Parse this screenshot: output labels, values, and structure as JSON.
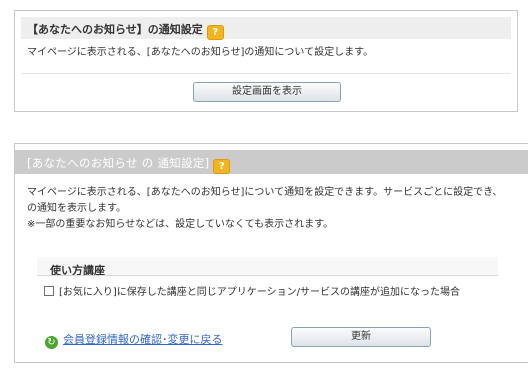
{
  "panel1": {
    "title": "【あなたへのお知らせ】の通知設定",
    "help_icon_label": "?",
    "description": "マイページに表示される、[あなたへのお知らせ]の通知について設定します。",
    "show_settings_button": "設定画面を表示"
  },
  "panel2": {
    "title": "[あなたへのお知らせ の 通知設定]",
    "help_icon_label": "?",
    "description_lines": [
      "マイページに表示される、[あなたへのお知らせ]について通知を設定できます。サービスごとに設定でき、",
      "の通知を表示します。",
      "※一部の重要なお知らせなどは、設定していなくても表示されます。"
    ],
    "section_title": "使い方講座",
    "checkbox_label": "[お気に入り]に保存した講座と同じアプリケーション/サービスの講座が追加になった場合",
    "checkbox_checked": false,
    "back_link": "会員登録情報の確認･変更に戻る",
    "back_icon": "circular-arrow-icon",
    "update_button": "更新"
  },
  "colors": {
    "help_icon": "#f3b51f",
    "panel2_header": "#cbcbcb",
    "link": "#3366cc",
    "back_icon": "#4aa52e"
  }
}
